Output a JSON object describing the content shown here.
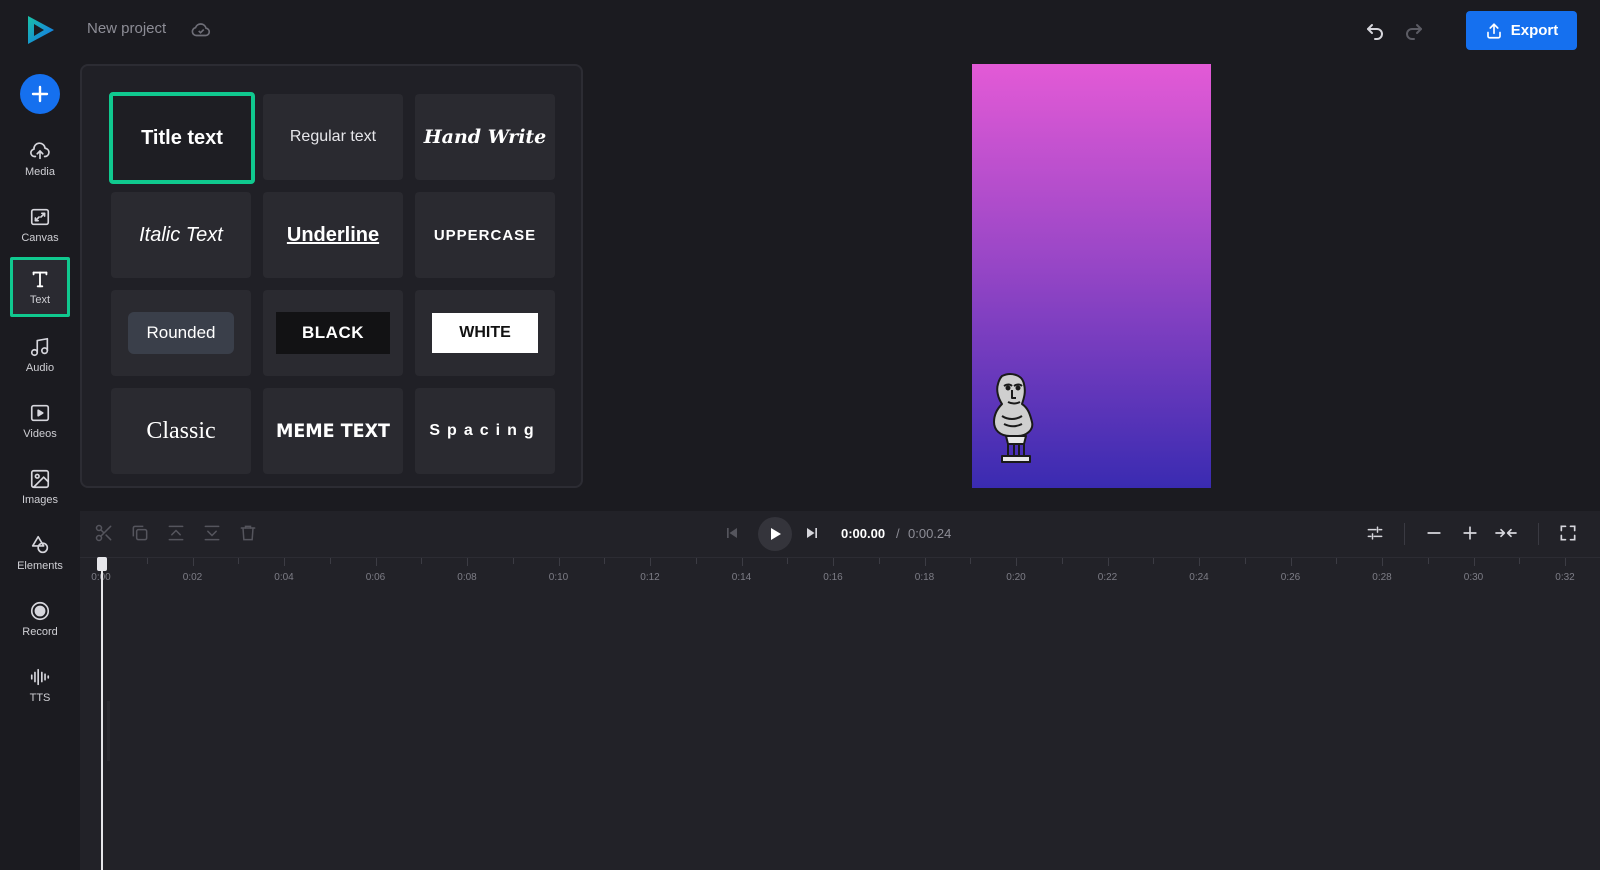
{
  "app": {
    "project_title": "New project",
    "export_label": "Export",
    "accent": "#1570ef",
    "highlight": "#10c98f"
  },
  "sidebar": {
    "items": [
      {
        "label": "Media",
        "icon": "upload-cloud-icon"
      },
      {
        "label": "Canvas",
        "icon": "canvas-resize-icon"
      },
      {
        "label": "Text",
        "icon": "text-t-icon",
        "active": true
      },
      {
        "label": "Audio",
        "icon": "music-note-icon"
      },
      {
        "label": "Videos",
        "icon": "video-play-icon"
      },
      {
        "label": "Images",
        "icon": "image-icon"
      },
      {
        "label": "Elements",
        "icon": "shapes-icon"
      },
      {
        "label": "Record",
        "icon": "record-icon"
      },
      {
        "label": "TTS",
        "icon": "sound-wave-icon"
      }
    ]
  },
  "text_panel": {
    "presets": [
      {
        "label": "Title text",
        "style": "title",
        "selected": true
      },
      {
        "label": "Regular text",
        "style": "regular"
      },
      {
        "label": "Hand Write",
        "style": "hand"
      },
      {
        "label": "Italic Text",
        "style": "italic"
      },
      {
        "label": "Underline",
        "style": "underline"
      },
      {
        "label": "UPPERCASE",
        "style": "upper"
      },
      {
        "label": "Rounded",
        "style": "rounded"
      },
      {
        "label": "BLACK",
        "style": "black"
      },
      {
        "label": "WHITE",
        "style": "white"
      },
      {
        "label": "Classic",
        "style": "classic"
      },
      {
        "label": "MEME TEXT",
        "style": "meme"
      },
      {
        "label": "Spacing",
        "style": "spacing"
      }
    ]
  },
  "timeline": {
    "current_time": "0:00.00",
    "separator": "/",
    "total_time": "0:00.24",
    "ruler_labels": [
      "0:00",
      "0:02",
      "0:04",
      "0:06",
      "0:08",
      "0:10",
      "0:12",
      "0:14",
      "0:16",
      "0:18",
      "0:20",
      "0:22",
      "0:24",
      "0:26",
      "0:28",
      "0:30",
      "0:32"
    ]
  }
}
